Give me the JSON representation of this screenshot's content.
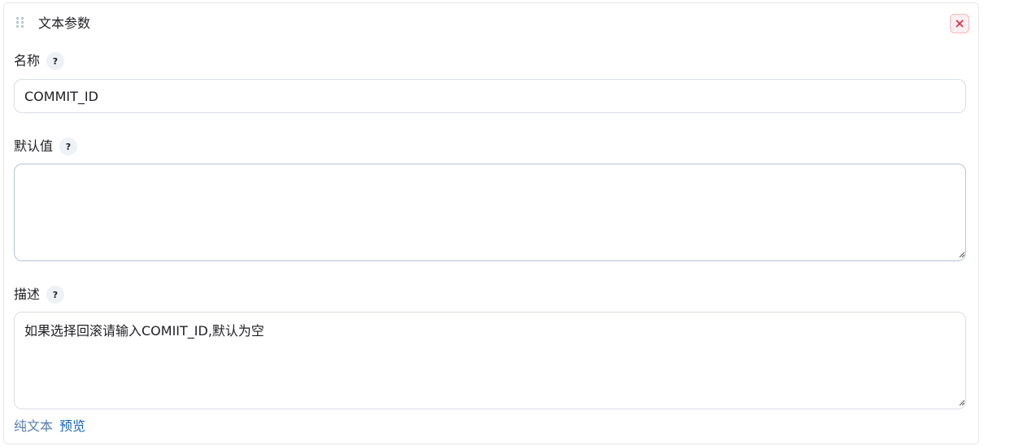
{
  "header": {
    "title": "文本参数",
    "close_symbol": "×"
  },
  "name_field": {
    "label": "名称",
    "help": "?",
    "value": "COMMIT_ID"
  },
  "default_field": {
    "label": "默认值",
    "help": "?",
    "value": ""
  },
  "description_field": {
    "label": "描述",
    "help": "?",
    "value": "如果选择回滚请输入COMIIT_ID,默认为空"
  },
  "footer_links": {
    "plain_text": "纯文本",
    "preview": "预览"
  },
  "colors": {
    "accent_link": "#1565c0",
    "muted_link": "#5b7fb0",
    "close_red": "#e0323f",
    "close_bg": "#fdeff1"
  },
  "icons": {
    "drag": "drag-handle-icon",
    "close": "close-icon",
    "help": "help-icon",
    "resize": "resize-grip-icon"
  }
}
